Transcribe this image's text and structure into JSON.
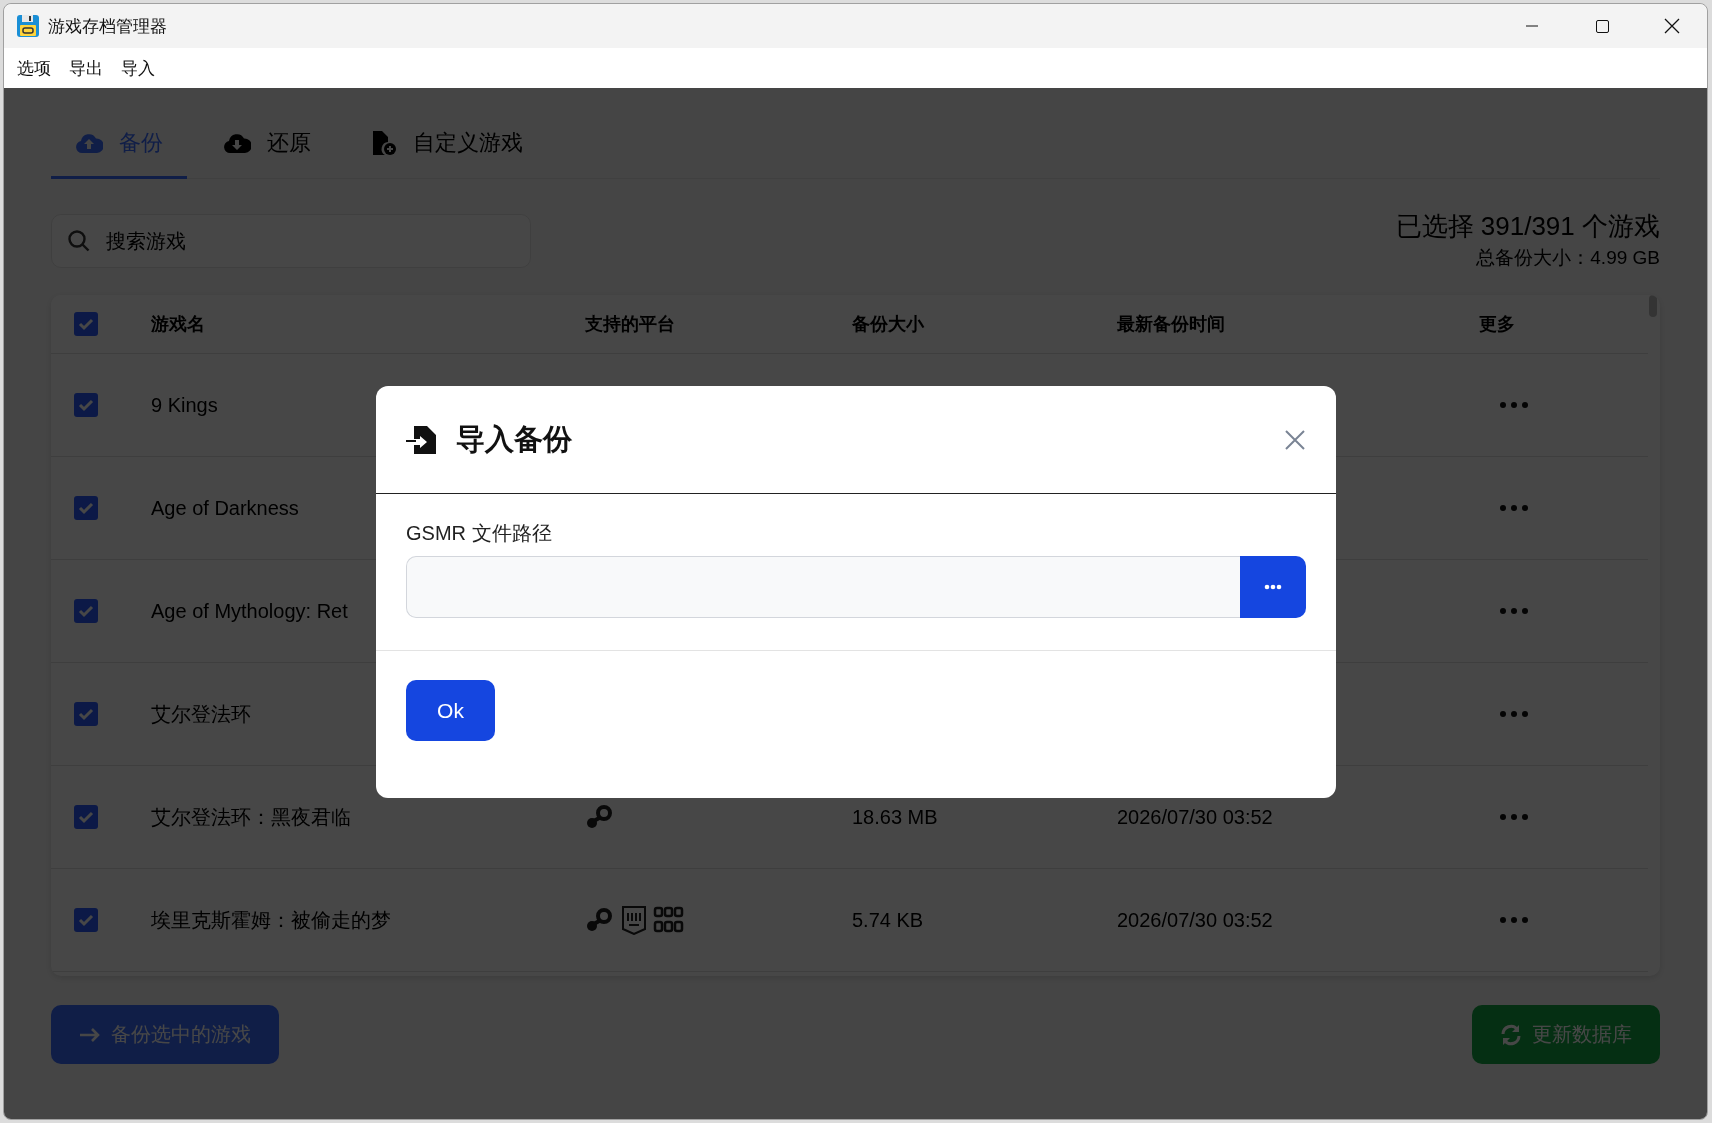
{
  "window": {
    "title": "游戏存档管理器"
  },
  "menu": [
    "选项",
    "导出",
    "导入"
  ],
  "tabs": [
    {
      "kind": "upload",
      "label": "备份",
      "selected": true
    },
    {
      "kind": "download",
      "label": "还原",
      "selected": false
    },
    {
      "kind": "add-file",
      "label": "自定义游戏",
      "selected": false
    }
  ],
  "search": {
    "placeholder": "搜索游戏"
  },
  "summary": {
    "selected": "已选择 391/391 个游戏",
    "total": "总备份大小：4.99 GB"
  },
  "table": {
    "all_checked": true,
    "columns": [
      "游戏名",
      "支持的平台",
      "备份大小",
      "最新备份时间",
      "更多"
    ],
    "rows": [
      {
        "checked": true,
        "name": "9 Kings"
      },
      {
        "checked": true,
        "name": "Age of Darkness"
      },
      {
        "checked": true,
        "name": "Age of Mythology: Ret"
      },
      {
        "checked": true,
        "name": "艾尔登法环"
      },
      {
        "checked": true,
        "name": "艾尔登法环：黑夜君临",
        "platforms": [
          {
            "kind": "steam"
          }
        ],
        "size": "18.63 MB",
        "time": "2026/07/30 03:52"
      },
      {
        "checked": true,
        "name": "埃里克斯霍姆：被偷走的梦",
        "platforms": [
          {
            "kind": "steam"
          },
          {
            "kind": "epic"
          },
          {
            "kind": "gog"
          }
        ],
        "size": "5.74 KB",
        "time": "2026/07/30 03:52"
      }
    ]
  },
  "actions": [
    {
      "kind": "backup",
      "label": "备份选中的游戏"
    },
    {
      "kind": "update",
      "label": "更新数据库"
    }
  ],
  "dialog": {
    "title": "导入备份",
    "field_label": "GSMR 文件路径",
    "ok": "Ok"
  }
}
